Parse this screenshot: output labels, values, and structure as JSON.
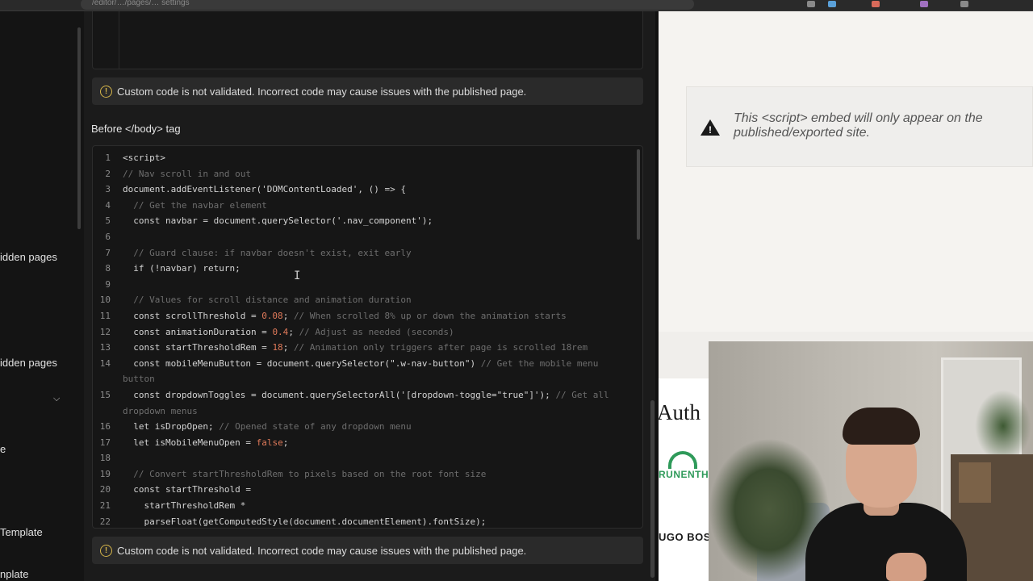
{
  "browser": {
    "url": "/editor/…/pages/… settings"
  },
  "left_nav": {
    "items": [
      {
        "label": "idden pages"
      },
      {
        "label": "idden pages"
      },
      {
        "label": "e"
      },
      {
        "label": "Template"
      },
      {
        "label": "nplate"
      }
    ]
  },
  "custom_code": {
    "notice_text": "Custom code is not validated. Incorrect code may cause issues with the published page.",
    "section_label": "Before </body> tag",
    "lines": [
      {
        "num": "1",
        "segments": [
          {
            "t": "<script>",
            "c": "kw"
          }
        ]
      },
      {
        "num": "2",
        "segments": [
          {
            "t": "// Nav scroll in and out",
            "c": "com"
          }
        ]
      },
      {
        "num": "3",
        "segments": [
          {
            "t": "document.addEventListener('DOMContentLoaded', () => {",
            "c": "kw"
          }
        ]
      },
      {
        "num": "4",
        "segments": [
          {
            "t": "  // Get the navbar element",
            "c": "com"
          }
        ]
      },
      {
        "num": "5",
        "segments": [
          {
            "t": "  const navbar = document.querySelector('.nav_component');",
            "c": "kw"
          }
        ]
      },
      {
        "num": "6",
        "segments": [
          {
            "t": "",
            "c": "kw"
          }
        ]
      },
      {
        "num": "7",
        "segments": [
          {
            "t": "  // Guard clause: if navbar doesn't exist, exit early",
            "c": "com"
          }
        ]
      },
      {
        "num": "8",
        "segments": [
          {
            "t": "  if (!navbar) return;",
            "c": "kw"
          }
        ]
      },
      {
        "num": "9",
        "segments": [
          {
            "t": "",
            "c": "kw"
          }
        ]
      },
      {
        "num": "10",
        "segments": [
          {
            "t": "  // Values for scroll distance and animation duration",
            "c": "com"
          }
        ]
      },
      {
        "num": "11",
        "segments": [
          {
            "t": "  const scrollThreshold = ",
            "c": "kw"
          },
          {
            "t": "0.08",
            "c": "num"
          },
          {
            "t": "; ",
            "c": "kw"
          },
          {
            "t": "// When scrolled 8% up or down the animation starts",
            "c": "com"
          }
        ]
      },
      {
        "num": "12",
        "segments": [
          {
            "t": "  const animationDuration = ",
            "c": "kw"
          },
          {
            "t": "0.4",
            "c": "num"
          },
          {
            "t": "; ",
            "c": "kw"
          },
          {
            "t": "// Adjust as needed (seconds)",
            "c": "com"
          }
        ]
      },
      {
        "num": "13",
        "segments": [
          {
            "t": "  const startThresholdRem = ",
            "c": "kw"
          },
          {
            "t": "18",
            "c": "num"
          },
          {
            "t": "; ",
            "c": "kw"
          },
          {
            "t": "// Animation only triggers after page is scrolled 18rem",
            "c": "com"
          }
        ]
      },
      {
        "num": "14",
        "segments": [
          {
            "t": "  const mobileMenuButton = document.querySelector(\".w-nav-button\") ",
            "c": "kw"
          },
          {
            "t": "// Get the mobile menu",
            "c": "com"
          }
        ]
      },
      {
        "num": "",
        "segments": [
          {
            "t": "button",
            "c": "com"
          }
        ]
      },
      {
        "num": "15",
        "segments": [
          {
            "t": "  const dropdownToggles = document.querySelectorAll('[dropdown-toggle=\"true\"]'); ",
            "c": "kw"
          },
          {
            "t": "// Get all",
            "c": "com"
          }
        ]
      },
      {
        "num": "",
        "segments": [
          {
            "t": "dropdown menus",
            "c": "com"
          }
        ]
      },
      {
        "num": "16",
        "segments": [
          {
            "t": "  let isDropOpen; ",
            "c": "kw"
          },
          {
            "t": "// Opened state of any dropdown menu",
            "c": "com"
          }
        ]
      },
      {
        "num": "17",
        "segments": [
          {
            "t": "  let isMobileMenuOpen = ",
            "c": "kw"
          },
          {
            "t": "false",
            "c": "num"
          },
          {
            "t": ";",
            "c": "kw"
          }
        ]
      },
      {
        "num": "18",
        "segments": [
          {
            "t": "",
            "c": "kw"
          }
        ]
      },
      {
        "num": "19",
        "segments": [
          {
            "t": "  // Convert startThresholdRem to pixels based on the root font size",
            "c": "com"
          }
        ]
      },
      {
        "num": "20",
        "segments": [
          {
            "t": "  const startThreshold =",
            "c": "kw"
          }
        ]
      },
      {
        "num": "21",
        "segments": [
          {
            "t": "    startThresholdRem *",
            "c": "kw"
          }
        ]
      },
      {
        "num": "22",
        "segments": [
          {
            "t": "    parseFloat(getComputedStyle(document.documentElement).fontSize);",
            "c": "kw"
          }
        ]
      }
    ]
  },
  "preview": {
    "embed_message": "This <script> embed will only appear on the published/exported site.",
    "author_heading": "Auth",
    "logo_text": "RUNENTHA",
    "brand_text": "UGO BOS"
  },
  "colors": {
    "warning": "#d6b64a",
    "number": "#e07a5a",
    "comment": "#6e6e6e",
    "logo_green": "#2f9a5a"
  }
}
